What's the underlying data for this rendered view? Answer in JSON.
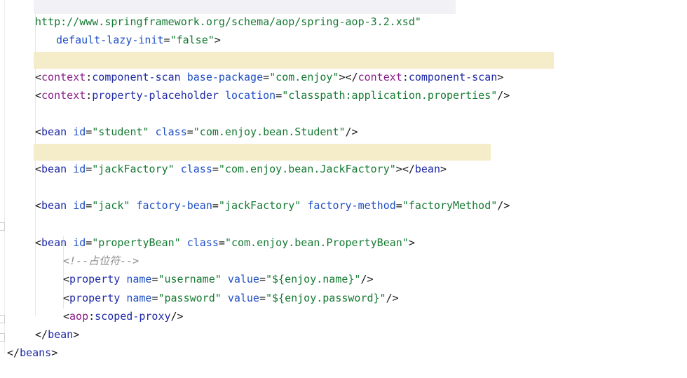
{
  "editor": {
    "lines": {
      "l1": {
        "url": "http://www.springframework.org/schema/aop/spring-aop-3.2.xsd\""
      },
      "l2": {
        "attr": "default-lazy-init",
        "eq": "=",
        "val": "\"false\"",
        "end": ">"
      },
      "l4": {
        "lt": "<",
        "ns": "context",
        "colon": ":",
        "tag": "component-scan",
        "attr": "base-package",
        "eq": "=",
        "val": "\"com.enjoy\"",
        "gt": ">",
        "close_lt": "</",
        "close_ns": "context",
        "close_colon": ":",
        "close_tag": "component-scan",
        "close_gt": ">"
      },
      "l5": {
        "lt": "<",
        "ns": "context",
        "colon": ":",
        "tag": "property-placeholder",
        "attr": "location",
        "eq": "=",
        "val": "\"classpath:application.properties\"",
        "end": "/>"
      },
      "l7": {
        "lt": "<",
        "tag": "bean",
        "attr1": "id",
        "eq1": "=",
        "val1": "\"student\"",
        "attr2": "class",
        "eq2": "=",
        "val2": "\"com.enjoy.bean.Student\"",
        "end": "/>"
      },
      "l9": {
        "lt": "<",
        "tag": "bean",
        "attr1": "id",
        "eq1": "=",
        "val1": "\"jackFactory\"",
        "attr2": "class",
        "eq2": "=",
        "val2": "\"com.enjoy.bean.JackFactory\"",
        "gt": ">",
        "close_lt": "</",
        "close_tag": "bean",
        "close_gt": ">"
      },
      "l11": {
        "lt": "<",
        "tag": "bean",
        "attr1": "id",
        "eq1": "=",
        "val1": "\"jack\"",
        "attr2": "factory-bean",
        "eq2": "=",
        "val2": "\"jackFactory\"",
        "attr3": "factory-method",
        "eq3": "=",
        "val3": "\"factoryMethod\"",
        "end": "/>"
      },
      "l13": {
        "lt": "<",
        "tag": "bean",
        "attr1": "id",
        "eq1": "=",
        "val1": "\"propertyBean\"",
        "attr2": "class",
        "eq2": "=",
        "val2": "\"com.enjoy.bean.PropertyBean\"",
        "gt": ">"
      },
      "l14": {
        "comment": "<!--占位符-->"
      },
      "l15": {
        "lt": "<",
        "tag": "property",
        "attr1": "name",
        "eq1": "=",
        "val1": "\"username\"",
        "attr2": "value",
        "eq2": "=",
        "val2": "\"${enjoy.name}\"",
        "end": "/>"
      },
      "l16": {
        "lt": "<",
        "tag": "property",
        "attr1": "name",
        "eq1": "=",
        "val1": "\"password\"",
        "attr2": "value",
        "eq2": "=",
        "val2": "\"${enjoy.password}\"",
        "end": "/>"
      },
      "l17": {
        "lt": "<",
        "ns": "aop",
        "colon": ":",
        "tag": "scoped-proxy",
        "end": "/>"
      },
      "l18": {
        "lt": "</",
        "tag": "bean",
        "gt": ">"
      },
      "l19": {
        "lt": "</",
        "tag": "beans",
        "gt": ">"
      }
    },
    "colors": {
      "tag": "#1f2aa6",
      "namespace": "#8a1c8a",
      "attribute": "#1f4fc4",
      "value": "#157a32",
      "comment": "#8c8c8c",
      "highlight": "#f5ecc9",
      "background": "#ffffff"
    }
  }
}
